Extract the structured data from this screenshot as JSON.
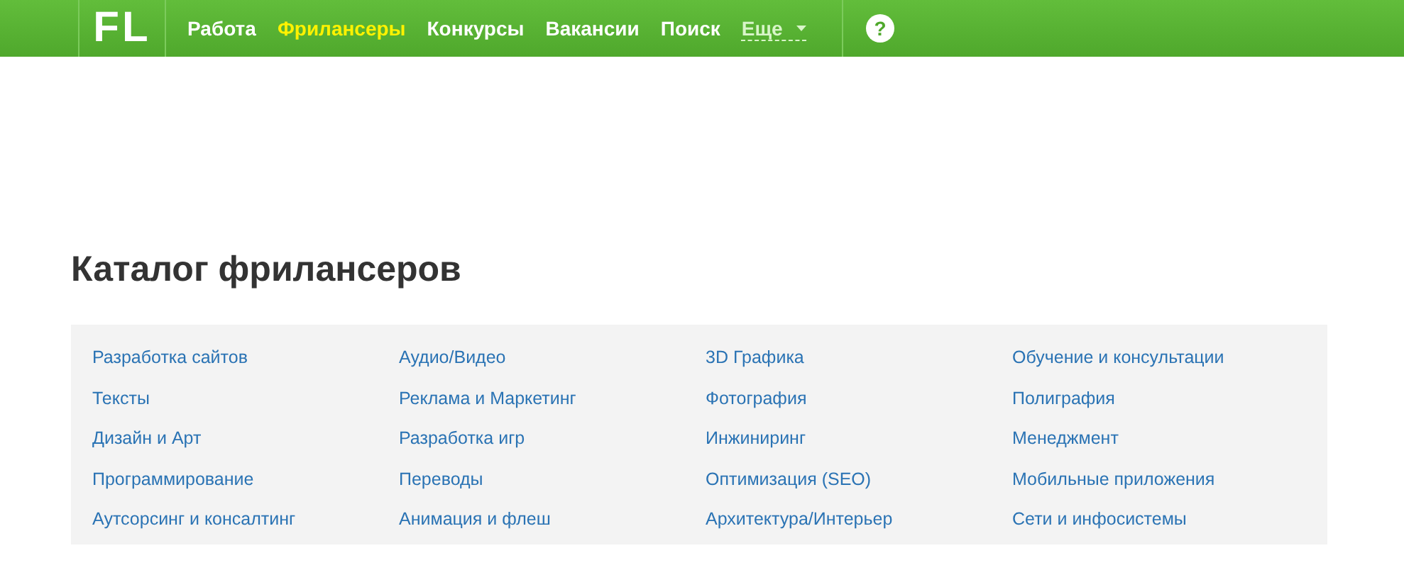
{
  "header": {
    "logo": "FL",
    "nav": [
      {
        "label": "Работа",
        "selected": false
      },
      {
        "label": "Фрилансеры",
        "selected": true
      },
      {
        "label": "Конкурсы",
        "selected": false
      },
      {
        "label": "Вакансии",
        "selected": false
      },
      {
        "label": "Поиск",
        "selected": false
      }
    ],
    "more": "Еще",
    "help": "?"
  },
  "catalog": {
    "title": "Каталог фрилансеров",
    "columns": [
      [
        "Разработка сайтов",
        "Тексты",
        "Дизайн и Арт",
        "Программирование",
        "Аутсорсинг и консалтинг"
      ],
      [
        "Аудио/Видео",
        "Реклама и Маркетинг",
        "Разработка игр",
        "Переводы",
        "Анимация и флеш"
      ],
      [
        "3D Графика",
        "Фотография",
        "Инжиниринг",
        "Оптимизация (SEO)",
        "Архитектура/Интерьер"
      ],
      [
        "Обучение и консультации",
        "Полиграфия",
        "Менеджмент",
        "Мобильные приложения",
        "Сети и инфосистемы"
      ]
    ]
  }
}
